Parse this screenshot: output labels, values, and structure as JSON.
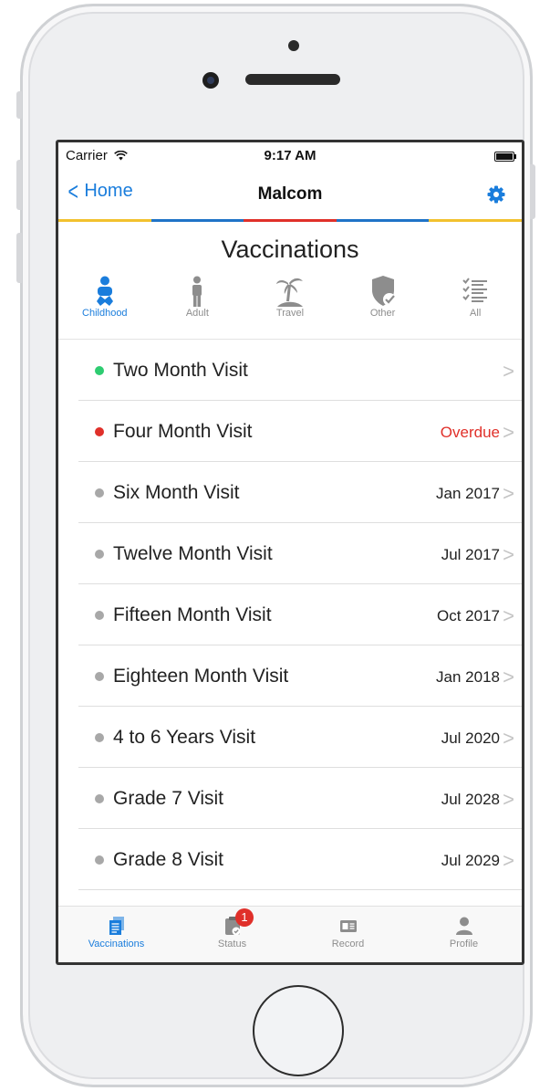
{
  "status_bar": {
    "carrier": "Carrier",
    "time": "9:17 AM"
  },
  "nav": {
    "back_label": "Home",
    "title": "Malcom"
  },
  "header": {
    "title": "Vaccinations"
  },
  "colors": {
    "accent": "#1a7ddc",
    "overdue": "#e0302a",
    "done": "#2ecc71",
    "pending": "#a8a8a8",
    "stripe": [
      "#f2c12e",
      "#1f73c7",
      "#e0302a",
      "#1f73c7",
      "#f2c12e"
    ]
  },
  "categories": [
    {
      "label": "Childhood",
      "icon": "baby-icon",
      "active": true
    },
    {
      "label": "Adult",
      "icon": "person-icon",
      "active": false
    },
    {
      "label": "Travel",
      "icon": "palm-tree-icon",
      "active": false
    },
    {
      "label": "Other",
      "icon": "shield-check-icon",
      "active": false
    },
    {
      "label": "All",
      "icon": "checklist-icon",
      "active": false
    }
  ],
  "visits": [
    {
      "name": "Two Month Visit",
      "due": "",
      "status": "done"
    },
    {
      "name": "Four Month Visit",
      "due": "Overdue",
      "status": "overdue"
    },
    {
      "name": "Six Month Visit",
      "due": "Jan 2017",
      "status": "pending"
    },
    {
      "name": "Twelve Month Visit",
      "due": "Jul 2017",
      "status": "pending"
    },
    {
      "name": "Fifteen Month Visit",
      "due": "Oct 2017",
      "status": "pending"
    },
    {
      "name": "Eighteen Month Visit",
      "due": "Jan 2018",
      "status": "pending"
    },
    {
      "name": "4 to 6 Years Visit",
      "due": "Jul 2020",
      "status": "pending"
    },
    {
      "name": "Grade 7 Visit",
      "due": "Jul 2028",
      "status": "pending"
    },
    {
      "name": "Grade 8 Visit",
      "due": "Jul 2029",
      "status": "pending"
    }
  ],
  "tabs": [
    {
      "label": "Vaccinations",
      "icon": "documents-icon",
      "active": true
    },
    {
      "label": "Status",
      "icon": "clipboard-icon",
      "active": false,
      "badge": "1"
    },
    {
      "label": "Record",
      "icon": "id-card-icon",
      "active": false
    },
    {
      "label": "Profile",
      "icon": "person-icon",
      "active": false
    }
  ]
}
